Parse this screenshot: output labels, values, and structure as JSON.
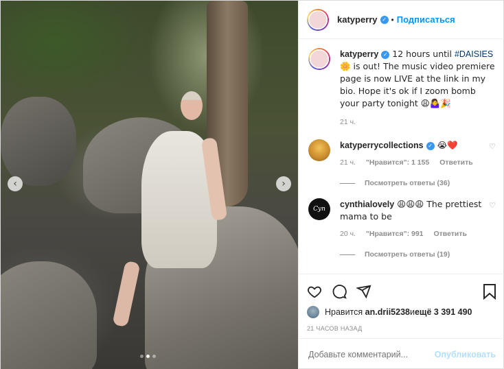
{
  "post": {
    "image_alt": "",
    "carousel": {
      "dots": 3,
      "active_index": 1
    },
    "nav_prev_icon": "chevron-left-icon",
    "nav_next_icon": "chevron-right-icon"
  },
  "header": {
    "username": "katyperry",
    "separator": "•",
    "follow_label": "Подписаться"
  },
  "caption": {
    "username": "katyperry",
    "text_before_tag": " 12 hours until ",
    "hashtag": "#DAISIES",
    "text_after_tag": " 🌼 is out! The music video premiere page is now LIVE at the link in my bio. Hope it's ok if I zoom bomb your party tonight 😩🤷‍♀️🎉",
    "time": "21 ч."
  },
  "comments": [
    {
      "username": "katyperrycollections",
      "text": " 😭❤️",
      "time": "21 ч.",
      "likes": "\"Нравится\": 1 155",
      "reply_label": "Ответить",
      "view_replies": "Посмотреть ответы (36)"
    },
    {
      "username": "cynthialovely",
      "text": " 😩😩😩 The prettiest mama to be",
      "time": "20 ч.",
      "likes": "\"Нравится\": 991",
      "reply_label": "Ответить",
      "view_replies": "Посмотреть ответы (19)",
      "avatar_text": "Cyn"
    }
  ],
  "actions": {
    "like_icon": "heart-icon",
    "comment_icon": "comment-icon",
    "share_icon": "share-icon",
    "save_icon": "bookmark-icon"
  },
  "likes": {
    "prefix": "Нравится ",
    "user": "an.drii5238",
    "middle": " и ",
    "count": "ещё 3 391 490"
  },
  "time_ago": "21 ЧАСОВ НАЗАД",
  "add_comment": {
    "placeholder": "Добавьте комментарий...",
    "publish_label": "Опубликовать"
  },
  "colors": {
    "link": "#0095f6",
    "hashtag": "#00376b",
    "verified": "#3897f0",
    "muted": "#8e8e8e"
  }
}
